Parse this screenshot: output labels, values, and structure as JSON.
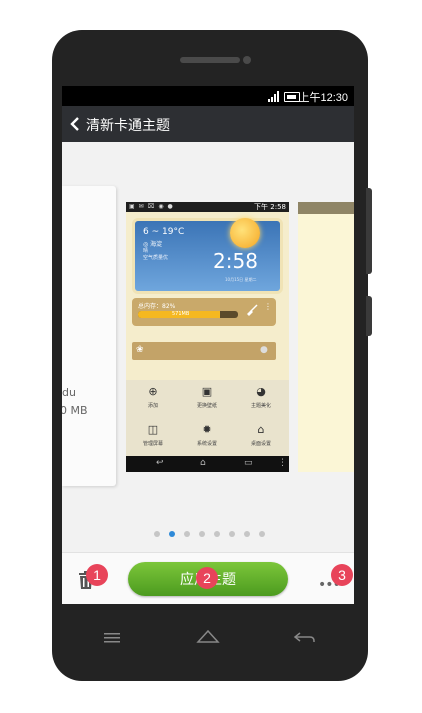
{
  "status_bar": {
    "time": "上午12:30"
  },
  "header": {
    "title": "清新卡通主题"
  },
  "left_card": {
    "line1": "du",
    "line2": "0 MB"
  },
  "preview": {
    "status_time": "下午 2:58",
    "weather": {
      "temp": "6 ~ 19°C",
      "city": "◎ 海淀",
      "line1": "晴",
      "line2": "空气质量优",
      "clock": "2:58",
      "date": "10月15日 星期二"
    },
    "memory": {
      "label": "总内存：82%",
      "bar_label": "571MB",
      "percent": 82
    },
    "grid": [
      {
        "icon": "add-icon",
        "glyph": "⊕",
        "label": "添加"
      },
      {
        "icon": "wallpaper-icon",
        "glyph": "▣",
        "label": "更换壁纸"
      },
      {
        "icon": "palette-icon",
        "glyph": "◕",
        "label": "主题美化"
      },
      {
        "icon": "screen-manage-icon",
        "glyph": "◫",
        "label": "管理屏幕"
      },
      {
        "icon": "gear-icon",
        "glyph": "✹",
        "label": "系统设置"
      },
      {
        "icon": "home-icon",
        "glyph": "⌂",
        "label": "桌面设置"
      }
    ]
  },
  "pager": {
    "count": 8,
    "active_index": 1
  },
  "bottom_bar": {
    "apply_label": "应用主题"
  },
  "badges": {
    "b1": "1",
    "b2": "2",
    "b3": "3"
  },
  "colors": {
    "accent_green": "#5aab2a",
    "badge_red": "#e8445a",
    "title_bar": "#2d2f33"
  }
}
